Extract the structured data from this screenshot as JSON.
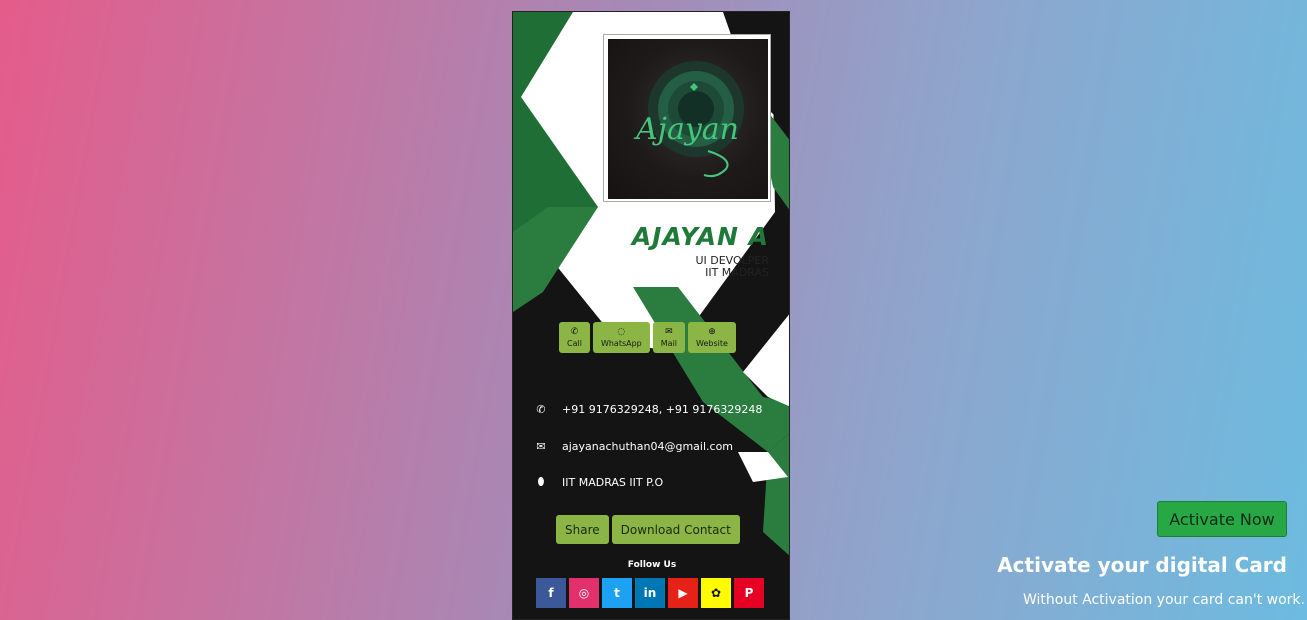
{
  "card": {
    "name": "AJAYAN A",
    "role_line1": "UI DEVOLPER",
    "role_line2": "IIT MADRAS",
    "photo_signature": "Ajayan",
    "quick_actions": [
      {
        "label": "Call",
        "icon": "phone-icon"
      },
      {
        "label": "WhatsApp",
        "icon": "whatsapp-icon"
      },
      {
        "label": "Mail",
        "icon": "mail-icon"
      },
      {
        "label": "Website",
        "icon": "globe-icon"
      }
    ],
    "phone": "+91 9176329248, +91 9176329248",
    "email": "ajayanachuthan04@gmail.com",
    "address": "IIT MADRAS IIT P.O",
    "share_label": "Share",
    "download_label": "Download Contact",
    "follow_label": "Follow Us",
    "social": [
      {
        "name": "facebook",
        "glyph": "f",
        "color": "#3b5998"
      },
      {
        "name": "instagram",
        "glyph": "◎",
        "color": "#e1306c"
      },
      {
        "name": "twitter",
        "glyph": "t",
        "color": "#1da1f2"
      },
      {
        "name": "linkedin",
        "glyph": "in",
        "color": "#0077b5"
      },
      {
        "name": "youtube",
        "glyph": "▶",
        "color": "#e62117"
      },
      {
        "name": "snapchat",
        "glyph": "✿",
        "color": "#fffc00"
      },
      {
        "name": "pinterest",
        "glyph": "P",
        "color": "#e60023"
      }
    ]
  },
  "activation": {
    "button_label": "Activate Now",
    "title": "Activate your digital Card",
    "subtitle": "Without Activation your card can't work."
  }
}
